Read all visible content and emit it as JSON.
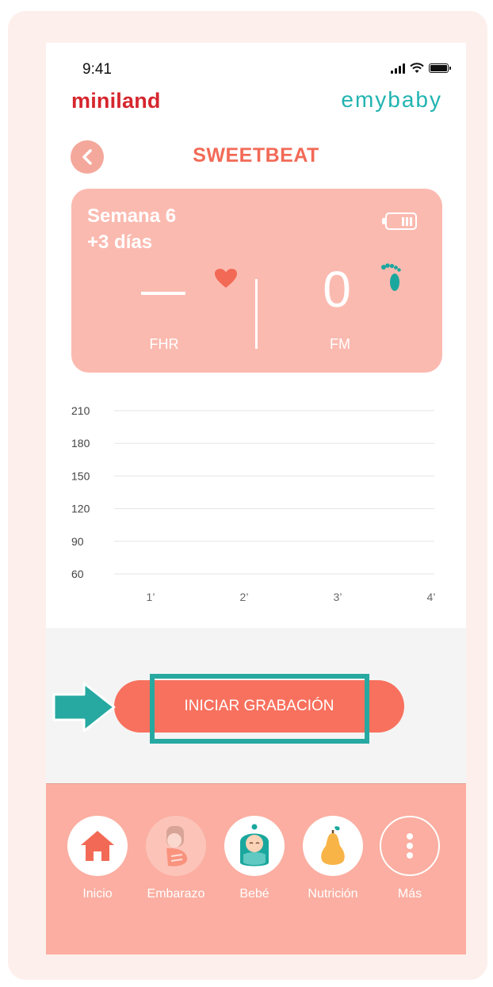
{
  "status": {
    "time": "9:41"
  },
  "brand": {
    "left": "miniland",
    "right": "emybaby"
  },
  "header": {
    "title": "SWEETBEAT"
  },
  "summary": {
    "week_line1": "Semana 6",
    "week_line2": "+3 días",
    "fhr_label": "FHR",
    "fm_value": "0",
    "fm_label": "FM"
  },
  "chart_data": {
    "type": "line",
    "y_ticks": [
      "210",
      "180",
      "150",
      "120",
      "90",
      "60"
    ],
    "x_ticks": [
      "1’",
      "2’",
      "3’",
      "4’"
    ],
    "ylim": [
      60,
      210
    ],
    "series": [],
    "grid": true
  },
  "action": {
    "record_label": "INICIAR GRABACIÓN"
  },
  "nav": {
    "items": [
      {
        "label": "Inicio",
        "icon": "home-icon"
      },
      {
        "label": "Embarazo",
        "icon": "pregnancy-icon"
      },
      {
        "label": "Bebé",
        "icon": "baby-icon"
      },
      {
        "label": "Nutrición",
        "icon": "pear-icon"
      },
      {
        "label": "Más",
        "icon": "more-icon"
      }
    ]
  },
  "colors": {
    "accent": "#f26a56",
    "card": "#fbbab0",
    "button": "#f8715e",
    "highlight": "#27a9a1",
    "nav": "#fbaea1"
  }
}
